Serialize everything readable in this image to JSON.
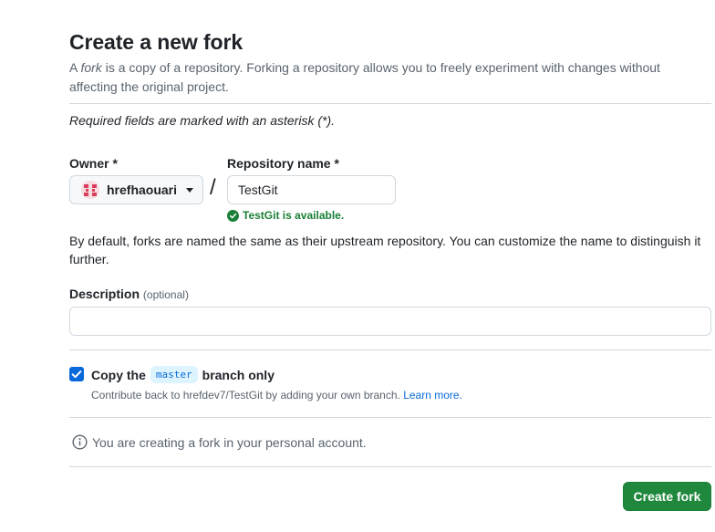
{
  "header": {
    "title": "Create a new fork",
    "intro_prefix": "A ",
    "intro_fork_word": "fork",
    "intro_rest": " is a copy of a repository. Forking a repository allows you to freely experiment with changes without affecting the original project."
  },
  "form": {
    "required_note": "Required fields are marked with an asterisk (*).",
    "owner_label": "Owner *",
    "owner_value": "hrefhaouari",
    "separator": "/",
    "repo_label": "Repository name *",
    "repo_value": "TestGit",
    "availability": "TestGit is available.",
    "default_note": "By default, forks are named the same as their upstream repository. You can customize the name to distinguish it further.",
    "description_label": "Description",
    "description_optional": "(optional)",
    "description_value": "",
    "copy_prefix": "Copy the",
    "copy_branch": "master",
    "copy_suffix": "branch only",
    "copy_checked": true,
    "contrib_text": "Contribute back to hrefdev7/TestGit by adding your own branch.",
    "learn_more": "Learn more.",
    "info_text": "You are creating a fork in your personal account.",
    "create_button": "Create fork"
  },
  "colors": {
    "primary_button": "#1f883d",
    "link": "#0969da",
    "success": "#1a7f37",
    "checkbox": "#0969da"
  },
  "icons": [
    "avatar",
    "caret-down-icon",
    "check-circle-icon",
    "checkmark-icon",
    "info-icon"
  ]
}
